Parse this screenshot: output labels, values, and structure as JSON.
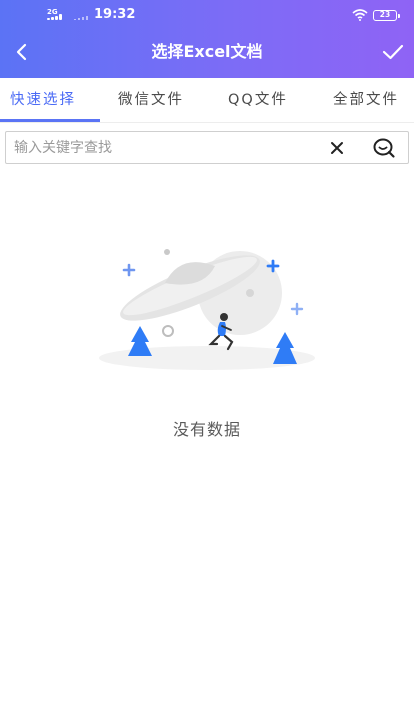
{
  "status_bar": {
    "network_label": "2G",
    "time": "19:32",
    "battery_level": "23"
  },
  "header": {
    "title": "选择Excel文档",
    "back_icon": "chevron-left-icon",
    "confirm_icon": "checkmark-icon"
  },
  "tabs": [
    {
      "label": "快速选择",
      "active": true
    },
    {
      "label": "微信文件",
      "active": false
    },
    {
      "label": "QQ文件",
      "active": false
    },
    {
      "label": "全部文件",
      "active": false
    }
  ],
  "search": {
    "placeholder": "输入关键字查找",
    "value": ""
  },
  "empty_state": {
    "message": "没有数据",
    "illustration": "ufo-empty-illustration"
  },
  "colors": {
    "header_start": "#5b73f5",
    "header_end": "#8f63f5",
    "accent": "#4b6bf5",
    "tree": "#2f7cf6"
  }
}
